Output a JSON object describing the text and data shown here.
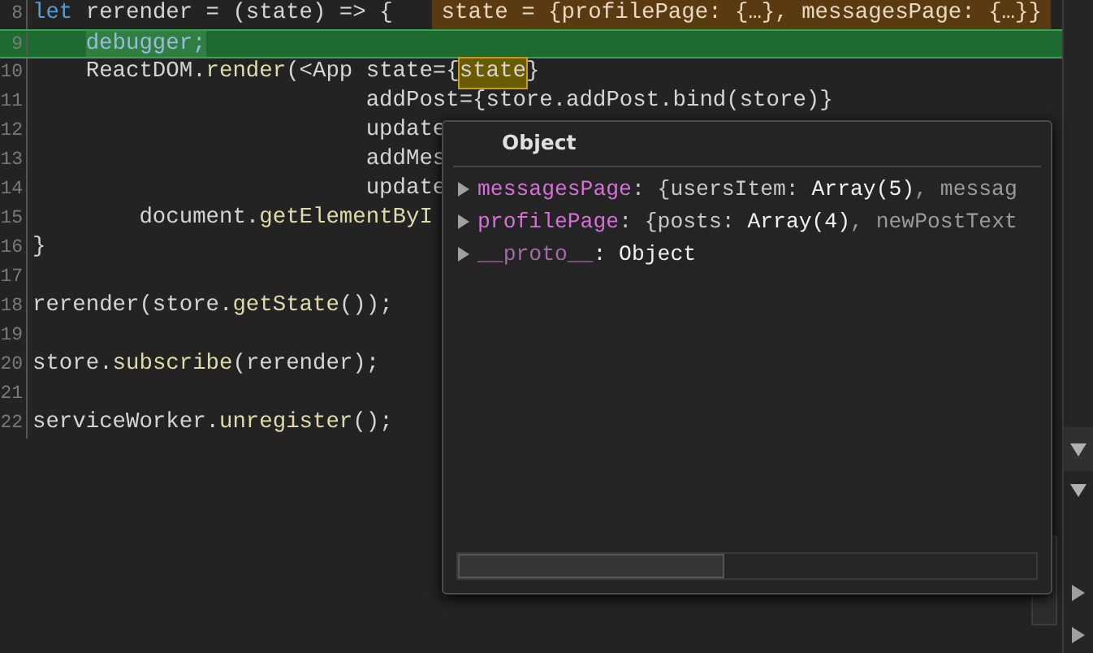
{
  "editor": {
    "lines": [
      {
        "number": "8",
        "paused": false,
        "tokens": [
          {
            "text": "let",
            "kind": "keyword"
          },
          {
            "text": " rerender = (state) => {",
            "kind": "plain"
          }
        ],
        "hint": "state = {profilePage: {…}, messagesPage: {…}}"
      },
      {
        "number": "9",
        "paused": true,
        "tokens": [
          {
            "text": "debugger;",
            "kind": "current"
          }
        ]
      },
      {
        "number": "10",
        "paused": false,
        "tokens": [
          {
            "text": "    ReactDOM.",
            "kind": "plain"
          },
          {
            "text": "render",
            "kind": "method"
          },
          {
            "text": "(<App state={",
            "kind": "plain"
          },
          {
            "text": "state",
            "kind": "hovered"
          },
          {
            "text": "}",
            "kind": "plain"
          }
        ]
      },
      {
        "number": "11",
        "paused": false,
        "tokens": [
          {
            "text": "                         addPost={store.addPost.bind(store)}",
            "kind": "plain"
          }
        ]
      },
      {
        "number": "12",
        "paused": false,
        "tokens": [
          {
            "text": "                         update",
            "kind": "plain"
          }
        ]
      },
      {
        "number": "13",
        "paused": false,
        "tokens": [
          {
            "text": "                         addMes",
            "kind": "plain"
          }
        ]
      },
      {
        "number": "14",
        "paused": false,
        "tokens": [
          {
            "text": "                         update",
            "kind": "plain"
          }
        ]
      },
      {
        "number": "15",
        "paused": false,
        "tokens": [
          {
            "text": "        document.",
            "kind": "plain"
          },
          {
            "text": "getElementByI",
            "kind": "method"
          }
        ]
      },
      {
        "number": "16",
        "paused": false,
        "tokens": [
          {
            "text": "}",
            "kind": "plain"
          }
        ]
      },
      {
        "number": "17",
        "paused": false
      },
      {
        "number": "18",
        "paused": false,
        "tokens": [
          {
            "text": "rerender(store.",
            "kind": "plain"
          },
          {
            "text": "getState",
            "kind": "method"
          },
          {
            "text": "());",
            "kind": "plain"
          }
        ]
      },
      {
        "number": "19",
        "paused": false
      },
      {
        "number": "20",
        "paused": false,
        "tokens": [
          {
            "text": "store.",
            "kind": "plain"
          },
          {
            "text": "subscribe",
            "kind": "method"
          },
          {
            "text": "(rerender);",
            "kind": "plain"
          }
        ]
      },
      {
        "number": "21",
        "paused": false
      },
      {
        "number": "22",
        "paused": false,
        "tokens": [
          {
            "text": "serviceWorker.",
            "kind": "plain"
          },
          {
            "text": "unregister",
            "kind": "method"
          },
          {
            "text": "();",
            "kind": "plain"
          }
        ]
      }
    ]
  },
  "popover": {
    "title": "Object",
    "rows": [
      {
        "key": "messagesPage",
        "expanded": false,
        "dimmed": false,
        "tokens": [
          {
            "text": ": {usersItem: ",
            "kind": "plain"
          },
          {
            "text": "Array(5)",
            "kind": "strong"
          },
          {
            "text": ", messag",
            "kind": "muted"
          }
        ]
      },
      {
        "key": "profilePage",
        "expanded": false,
        "dimmed": false,
        "tokens": [
          {
            "text": ": {posts: ",
            "kind": "plain"
          },
          {
            "text": "Array(4)",
            "kind": "strong"
          },
          {
            "text": ", newPostText",
            "kind": "muted"
          }
        ]
      },
      {
        "key": "__proto__",
        "expanded": false,
        "dimmed": true,
        "tokens": [
          {
            "text": ": Object",
            "kind": "strong"
          }
        ]
      }
    ]
  }
}
